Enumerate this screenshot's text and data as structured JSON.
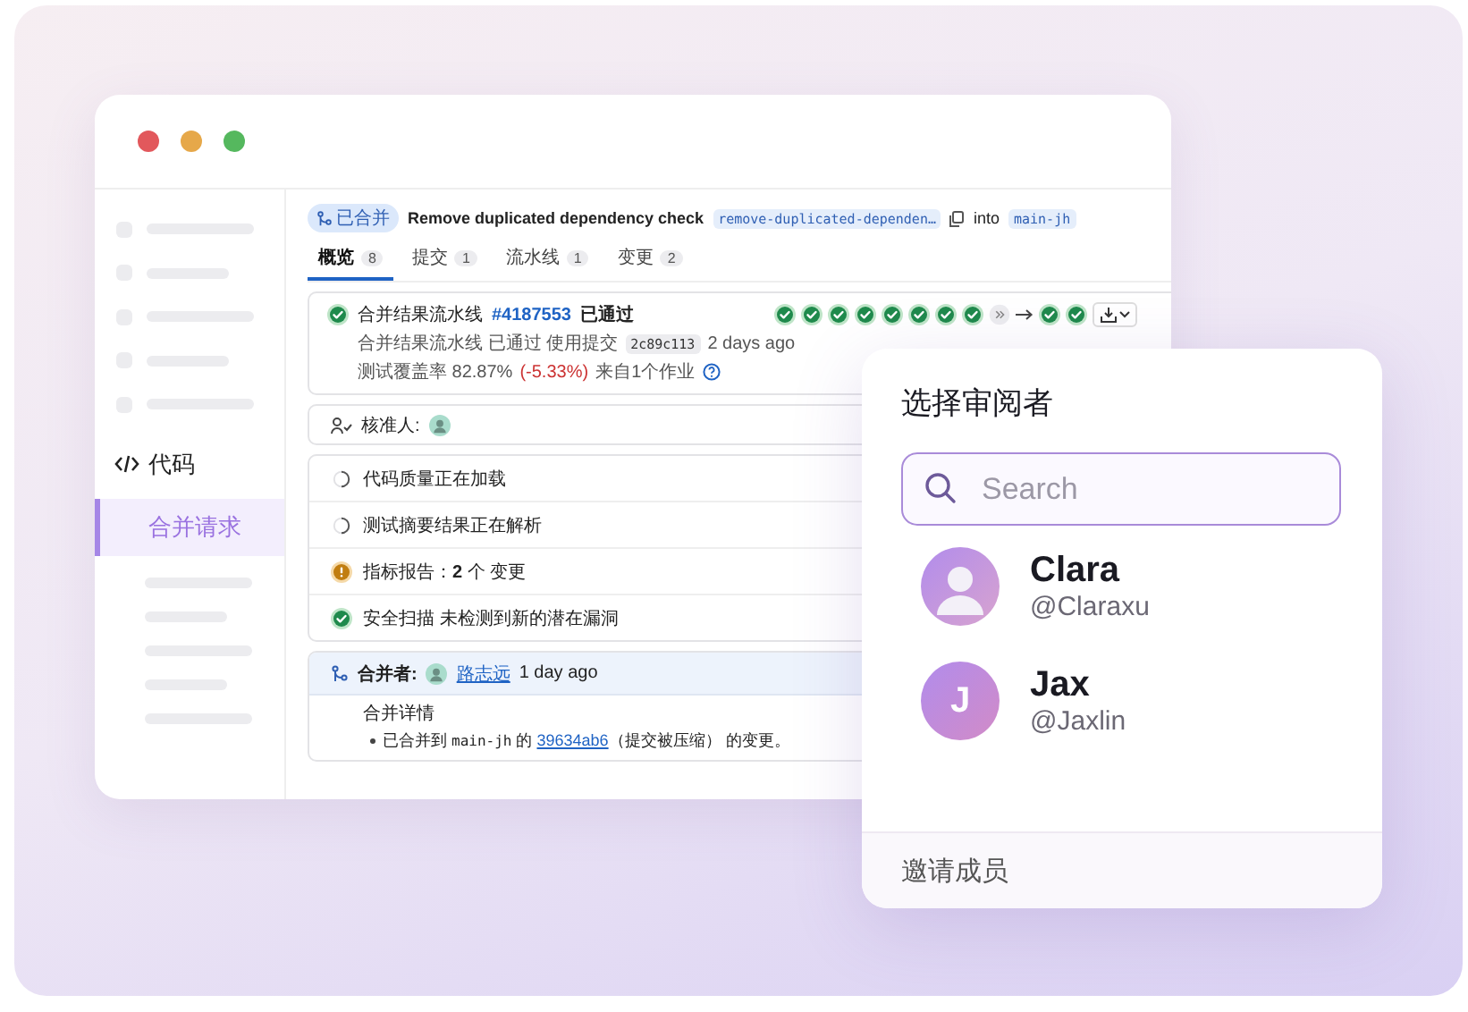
{
  "window": {
    "sidebar": {
      "section": {
        "label": "代码"
      },
      "items": [
        {
          "label": "合并请求",
          "selected": true
        }
      ]
    },
    "merge_request": {
      "status_badge": "已合并",
      "title": "Remove duplicated dependency check",
      "source_branch": "remove-duplicated-dependen…",
      "into": "into",
      "target_branch": "main-jh",
      "tabs": [
        {
          "label": "概览",
          "count": "8",
          "selected": true
        },
        {
          "label": "提交",
          "count": "1",
          "selected": false
        },
        {
          "label": "流水线",
          "count": "1",
          "selected": false
        },
        {
          "label": "变更",
          "count": "2",
          "selected": false
        }
      ],
      "pipeline": {
        "title": "合并结果流水线",
        "id": "#4187553",
        "status": "已通过",
        "detail": "合并结果流水线 已通过 使用提交",
        "commit": "2c89c113",
        "time": "2 days ago",
        "coverage": "测试覆盖率 82.87%",
        "coverage_delta": "(-5.33%)",
        "coverage_source": "来自1个作业",
        "stages": [
          {
            "kind": "success"
          },
          {
            "kind": "success"
          },
          {
            "kind": "success"
          },
          {
            "kind": "success"
          },
          {
            "kind": "success"
          },
          {
            "kind": "success"
          },
          {
            "kind": "success"
          },
          {
            "kind": "success"
          },
          {
            "kind": "skipped"
          },
          {
            "kind": "success"
          },
          {
            "kind": "success"
          }
        ]
      },
      "approval": {
        "label": "核准人:"
      },
      "checks": [
        {
          "kind": "loading",
          "text": "代码质量正在加载"
        },
        {
          "kind": "loading",
          "text": "测试摘要结果正在解析"
        },
        {
          "kind": "warning",
          "text": "指标报告：**2** 个 变更"
        },
        {
          "kind": "success",
          "text": "安全扫描 未检测到新的潜在漏洞"
        }
      ],
      "merged": {
        "label": "合并者:",
        "user": "路志远",
        "time": "1 day ago",
        "details_title": "合并详情",
        "detail_prefix": "已合并到",
        "detail_branch": "main-jh",
        "detail_mid": "的",
        "detail_commit": "39634ab6",
        "detail_suffix": "（提交被压缩） 的变更。"
      }
    }
  },
  "reviewer_popup": {
    "title": "选择审阅者",
    "search": {
      "placeholder": "Search"
    },
    "reviewers": [
      {
        "kind": "photo",
        "name": "Clara",
        "handle": "@Claraxu"
      },
      {
        "kind": "initial",
        "initial": "J",
        "name": "Jax",
        "handle": "@Jaxlin"
      }
    ],
    "footer": "邀请成员"
  }
}
